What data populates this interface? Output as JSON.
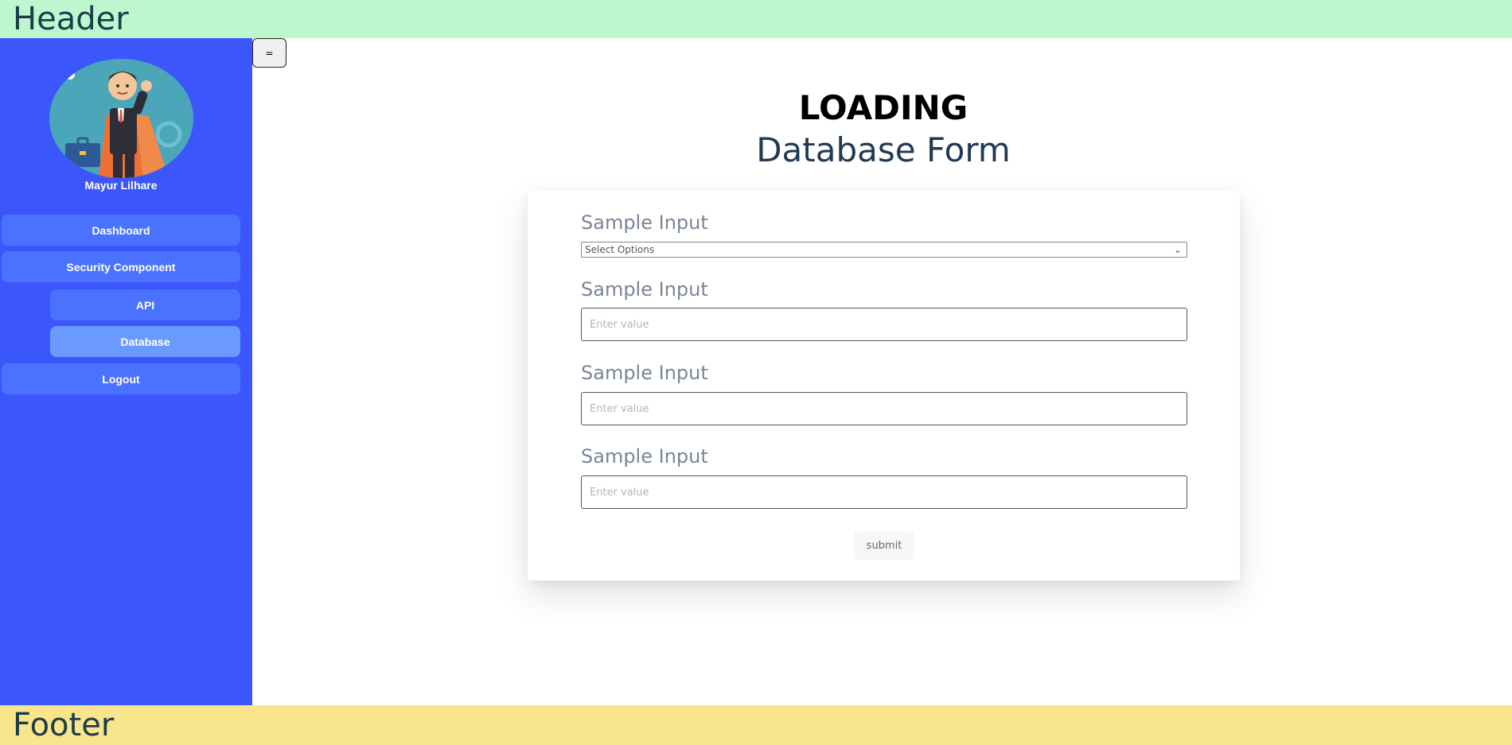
{
  "header": {
    "title": "Header"
  },
  "footer": {
    "title": "Footer"
  },
  "sidebar": {
    "user_name": "Mayur Lilhare",
    "avatar_icon": "superhero-businessman-avatar",
    "items": [
      {
        "label": "Dashboard"
      },
      {
        "label": "Security Component"
      },
      {
        "label": "API"
      },
      {
        "label": "Database"
      },
      {
        "label": "Logout"
      }
    ],
    "active_item": "Database"
  },
  "toolbar": {
    "toggle_label": "="
  },
  "main": {
    "logo_text": "LOADING",
    "title": "Database Form",
    "form": {
      "fields": [
        {
          "label": "Sample Input",
          "select_value": "Select Options"
        },
        {
          "label": "Sample Input",
          "placeholder": "Enter value"
        },
        {
          "label": "Sample Input",
          "placeholder": "Enter value"
        },
        {
          "label": "Sample Input",
          "placeholder": "Enter value"
        }
      ],
      "submit_label": "submit"
    }
  },
  "colors": {
    "header_bg": "#bef7cf",
    "footer_bg": "#f9e58c",
    "sidebar_bg": "#3b57fc",
    "nav_button": "#4b72ff",
    "nav_button_active": "#6a9aff"
  }
}
